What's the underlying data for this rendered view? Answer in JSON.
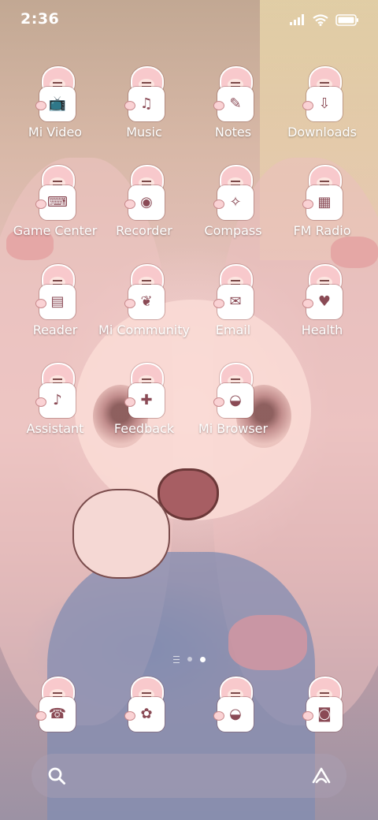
{
  "status_bar": {
    "time": "2:36",
    "icons": [
      "signal-icon",
      "wifi-icon",
      "battery-icon"
    ]
  },
  "apps": [
    {
      "label": "Mi Video",
      "icon": "tv-icon"
    },
    {
      "label": "Music",
      "icon": "music-icon"
    },
    {
      "label": "Notes",
      "icon": "notes-icon"
    },
    {
      "label": "Downloads",
      "icon": "download-icon"
    },
    {
      "label": "Game Center",
      "icon": "gamepad-icon"
    },
    {
      "label": "Recorder",
      "icon": "recorder-icon"
    },
    {
      "label": "Compass",
      "icon": "compass-icon"
    },
    {
      "label": "FM Radio",
      "icon": "radio-icon"
    },
    {
      "label": "Reader",
      "icon": "book-icon"
    },
    {
      "label": "Mi Community",
      "icon": "cherry-icon"
    },
    {
      "label": "Email",
      "icon": "mail-icon"
    },
    {
      "label": "Health",
      "icon": "heart-icon"
    },
    {
      "label": "Assistant",
      "icon": "microphone-icon"
    },
    {
      "label": "Feedback",
      "icon": "feedback-icon"
    },
    {
      "label": "Mi Browser",
      "icon": "browser-icon"
    }
  ],
  "page_indicator": {
    "pages": 2,
    "active_page": 2
  },
  "dock": [
    {
      "icon": "phone-icon"
    },
    {
      "icon": "messages-icon"
    },
    {
      "icon": "browser-icon"
    },
    {
      "icon": "camera-icon"
    }
  ],
  "search_bar": {
    "icon": "search-icon",
    "right_icon": "assistant-icon"
  },
  "colors": {
    "label": "#ffffff",
    "badge_accent": "#8a4a55",
    "hair_pink": "#f8c9cc"
  }
}
